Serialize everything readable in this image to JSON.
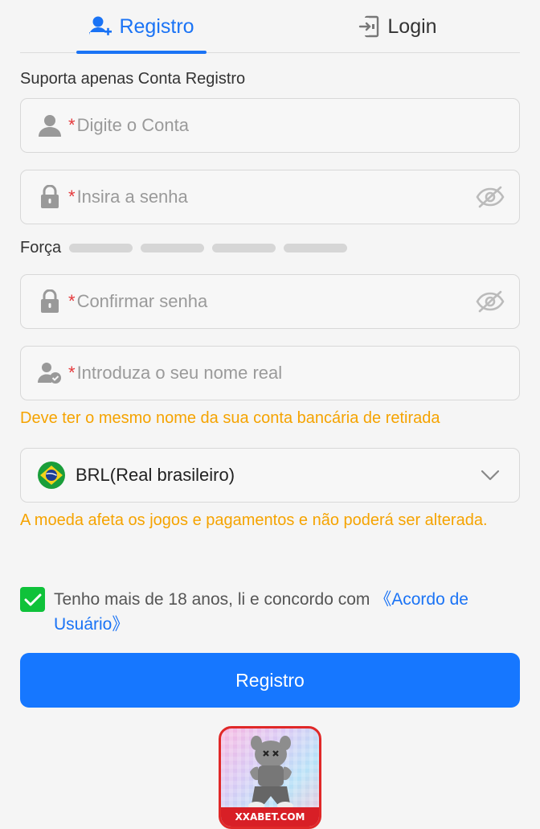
{
  "tabs": {
    "register_label": "Registro",
    "login_label": "Login"
  },
  "form": {
    "support_hint": "Suporta apenas Conta Registro",
    "required_mark": "*",
    "account_placeholder": "Digite o Conta",
    "password_placeholder": "Insira a senha",
    "strength_label": "Força",
    "confirm_placeholder": "Confirmar senha",
    "realname_placeholder": "Introduza o seu nome real",
    "realname_warning": "Deve ter o mesmo nome da sua conta bancária de retirada",
    "currency_value": "BRL(Real brasileiro)",
    "currency_warning": "A moeda afeta os jogos e pagamentos e não poderá ser alterada.",
    "agree_text": "Tenho mais de 18 anos, li e concordo com ",
    "agree_link": "《Acordo de Usuário》",
    "agree_checked": true,
    "submit_label": "Registro"
  },
  "promo": {
    "brand": "XXABET.COM"
  },
  "colors": {
    "accent": "#1677ff",
    "warning": "#f5a300",
    "required": "#e5383b",
    "check": "#0fc23a"
  }
}
